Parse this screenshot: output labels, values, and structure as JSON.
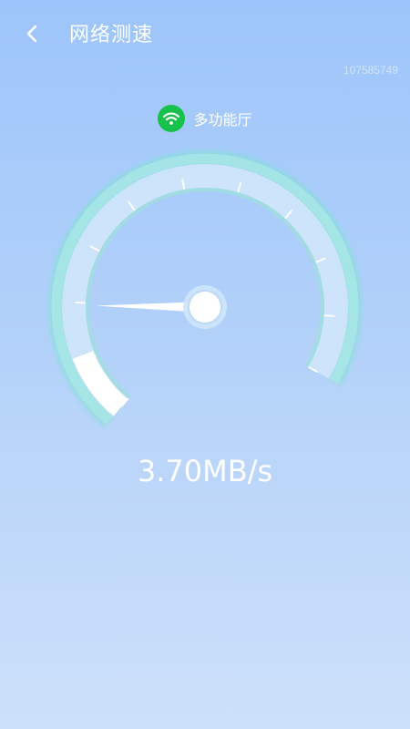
{
  "header": {
    "title": "网络测速"
  },
  "device_id": "107585749",
  "network": {
    "name": "多功能厅"
  },
  "gauge": {
    "progress": 0.11,
    "needle_fraction": 0.195
  },
  "speed": {
    "value": "3.70MB/s"
  },
  "icons": {
    "back": "chevron-left-icon",
    "wifi": "wifi-icon"
  },
  "colors": {
    "wifi_badge": "#18c24a",
    "gauge_glow": "#7de3d2"
  }
}
